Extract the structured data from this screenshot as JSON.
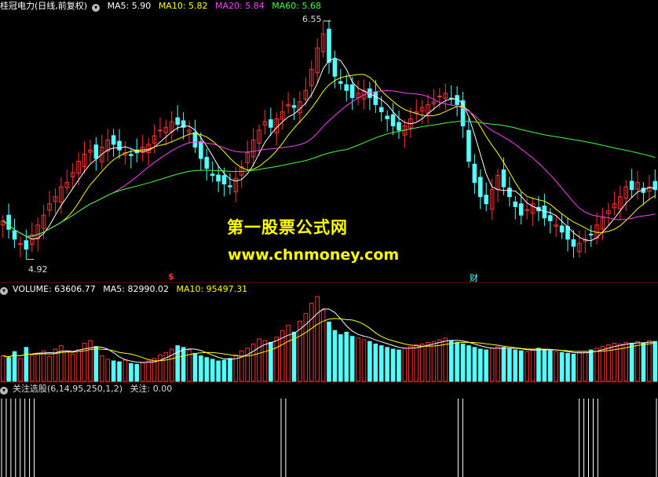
{
  "header": {
    "stock_name": "桂冠电力",
    "period": "(日线,前复权)",
    "ma_labels": [
      "MA5: 5.90",
      "MA10: 5.82",
      "MA20: 5.84",
      "MA60: 5.68"
    ],
    "ma_colors": [
      "#ffffff",
      "#ffff00",
      "#ff40ff",
      "#40ff40"
    ]
  },
  "volume_header": {
    "labels": [
      "VOLUME: 63606.77",
      "MA5: 82990.02",
      "MA10: 95497.31"
    ],
    "colors": [
      "#ffffff",
      "#ffffff",
      "#ffff00"
    ]
  },
  "indicator_header": {
    "label": "关注选股(6,14,95,250,1,2)",
    "value": "关注: 0.00"
  },
  "markers": {
    "high": "6.55",
    "low": "4.92",
    "dollar": "$",
    "cai": "财"
  },
  "watermark": {
    "line1": "第一股票公式网",
    "line2": "www.chnmoney.com"
  },
  "colors": {
    "up": "#ff3232",
    "down": "#54ffff",
    "ma5": "#ffffff",
    "ma10": "#ffff00",
    "ma20": "#ff40ff",
    "ma60": "#40ff40"
  },
  "chart_data": {
    "type": "candlestick",
    "price_range": [
      4.92,
      6.55
    ],
    "close_series": [
      5.18,
      5.12,
      5.05,
      5.02,
      4.98,
      5.08,
      5.15,
      5.22,
      5.3,
      5.35,
      5.42,
      5.45,
      5.52,
      5.6,
      5.65,
      5.68,
      5.62,
      5.7,
      5.75,
      5.72,
      5.68,
      5.66,
      5.64,
      5.66,
      5.7,
      5.72,
      5.78,
      5.82,
      5.84,
      5.88,
      5.86,
      5.84,
      5.82,
      5.7,
      5.62,
      5.55,
      5.5,
      5.46,
      5.44,
      5.42,
      5.48,
      5.56,
      5.66,
      5.75,
      5.82,
      5.88,
      5.84,
      5.9,
      5.95,
      6.0,
      5.98,
      6.02,
      6.1,
      6.25,
      6.4,
      6.5,
      6.3,
      6.2,
      6.15,
      6.1,
      6.05,
      6.08,
      6.1,
      6.05,
      6.0,
      5.95,
      5.9,
      5.85,
      5.82,
      5.85,
      5.9,
      5.95,
      5.98,
      6.0,
      6.02,
      6.06,
      6.08,
      6.04,
      6.0,
      5.85,
      5.6,
      5.45,
      5.35,
      5.3,
      5.4,
      5.5,
      5.42,
      5.35,
      5.28,
      5.22,
      5.26,
      5.3,
      5.25,
      5.2,
      5.18,
      5.15,
      5.1,
      5.05,
      5.0,
      5.02,
      5.05,
      5.08,
      5.15,
      5.2,
      5.25,
      5.3,
      5.35,
      5.42,
      5.4,
      5.45,
      5.38,
      5.42,
      5.4
    ]
  },
  "volume_data": {
    "volumes": [
      30,
      28,
      35,
      27,
      40,
      31,
      33,
      36,
      29,
      38,
      42,
      35,
      32,
      37,
      45,
      48,
      41,
      30,
      26,
      24,
      23,
      25,
      21,
      20,
      22,
      24,
      27,
      31,
      34,
      38,
      42,
      40,
      37,
      33,
      30,
      28,
      26,
      24,
      25,
      27,
      31,
      36,
      39,
      44,
      50,
      48,
      46,
      52,
      60,
      66,
      58,
      71,
      80,
      92,
      100,
      84,
      70,
      60,
      55,
      58,
      53,
      51,
      49,
      47,
      44,
      42,
      40,
      38,
      37,
      39,
      41,
      43,
      44,
      46,
      47,
      49,
      51,
      48,
      46,
      44,
      42,
      40,
      38,
      37,
      39,
      41,
      40,
      38,
      37,
      36,
      35,
      38,
      39,
      37,
      36,
      35,
      34,
      33,
      32,
      34,
      35,
      37,
      39,
      41,
      43,
      45,
      44,
      46,
      45,
      47,
      45,
      48,
      47
    ]
  }
}
